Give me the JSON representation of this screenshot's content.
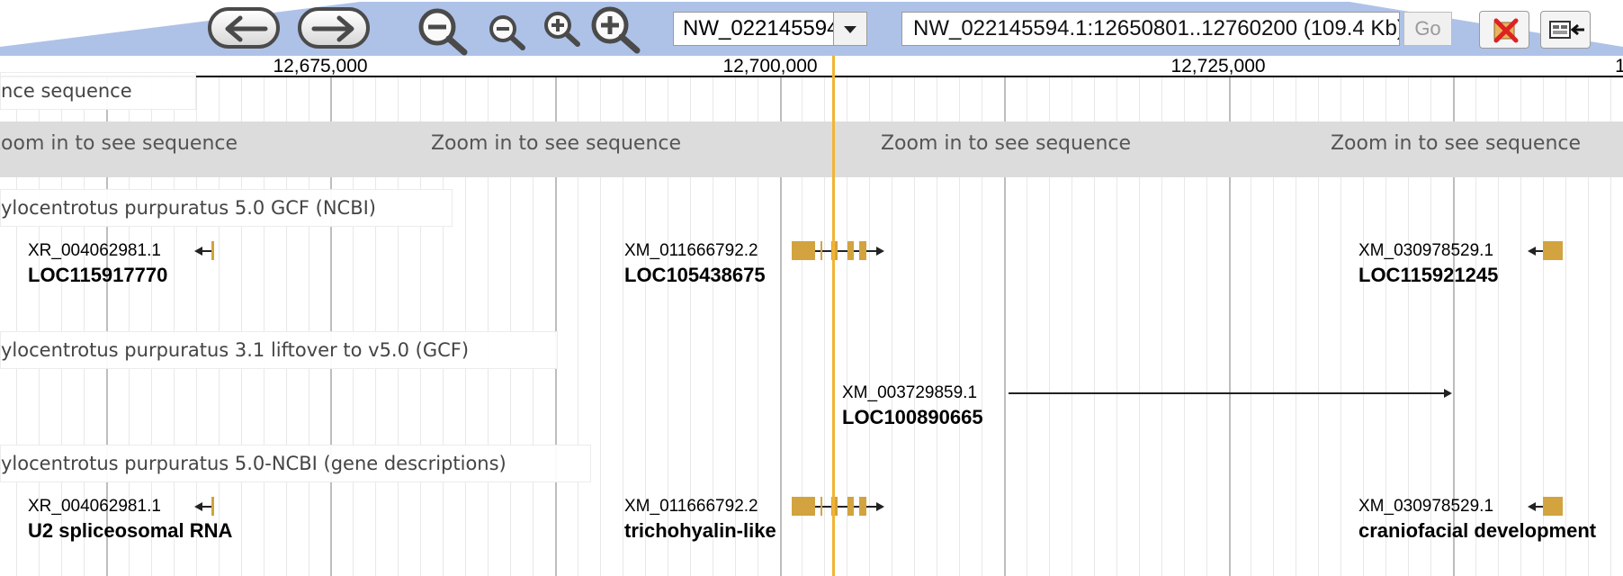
{
  "navigation": {
    "back_icon": "left-arrow-icon",
    "forward_icon": "right-arrow-icon",
    "zoom_out_big_icon": "zoom-out-large-icon",
    "zoom_out_small_icon": "zoom-out-small-icon",
    "zoom_in_small_icon": "zoom-in-small-icon",
    "zoom_in_big_icon": "zoom-in-large-icon",
    "reference_sequence": "NW_022145594.1",
    "location": "NW_022145594.1:12650801..12760200 (109.4 Kb)",
    "go_label": "Go",
    "highlight_icon": "clear-highlight-icon",
    "tracks_icon": "show-tracks-icon"
  },
  "ruler": {
    "labels": [
      "12,675,000",
      "12,700,000",
      "12,725,000",
      "1"
    ]
  },
  "tracks": {
    "reference": {
      "label": "nce sequence",
      "zoom_message": "Zoom in to see sequence"
    },
    "gcf_ncbi": {
      "label": "ylocentrotus purpuratus 5.0 GCF (NCBI)",
      "features": [
        {
          "id": "XR_004062981.1",
          "name": "LOC115917770"
        },
        {
          "id": "XM_011666792.2",
          "name": "LOC105438675"
        },
        {
          "id": "XM_030978529.1",
          "name": "LOC115921245"
        }
      ]
    },
    "liftover": {
      "label": "ylocentrotus purpuratus 3.1 liftover to v5.0 (GCF)",
      "features": [
        {
          "id": "XM_003729859.1",
          "name": "LOC100890665"
        }
      ]
    },
    "descriptions": {
      "label": "ylocentrotus purpuratus 5.0-NCBI (gene descriptions)",
      "features": [
        {
          "id": "XR_004062981.1",
          "name": "U2 spliceosomal RNA"
        },
        {
          "id": "XM_011666792.2",
          "name": "trichohyalin-like"
        },
        {
          "id": "XM_030978529.1",
          "name": "craniofacial development"
        }
      ]
    }
  },
  "colors": {
    "nav_band": "#aec2e8",
    "feature": "#d2a33f",
    "highlight": "#f2b436",
    "sequence_band": "#dcdcdc"
  }
}
